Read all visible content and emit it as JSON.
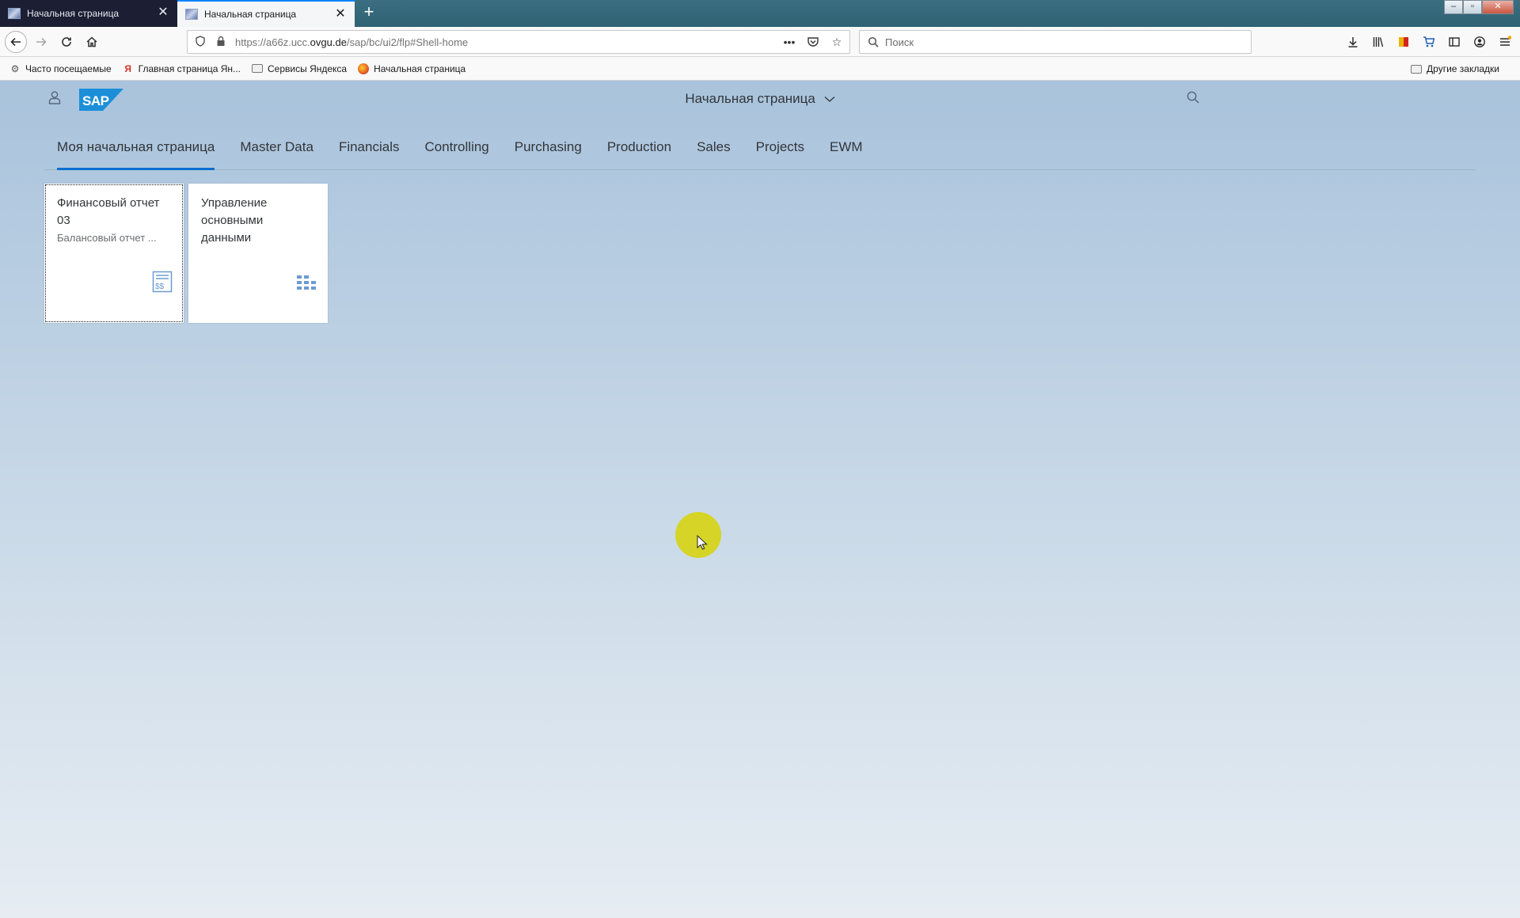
{
  "browser": {
    "tabs": [
      {
        "title": "Начальная страница",
        "active": false
      },
      {
        "title": "Начальная страница",
        "active": true
      }
    ],
    "new_tab_symbol": "+",
    "close_symbol": "✕",
    "window_controls": {
      "minimize": "–",
      "maximize": "▫",
      "close": "✕"
    },
    "url": {
      "prefix": "https://a66z.ucc.",
      "domain": "ovgu.de",
      "path": "/sap/bc/ui2/flp#Shell-home"
    },
    "search_placeholder": "Поиск",
    "bookmarks": [
      {
        "label": "Часто посещаемые",
        "icon": "gear-icon"
      },
      {
        "label": "Главная страница Ян...",
        "icon": "yandex-icon"
      },
      {
        "label": "Сервисы Яндекса",
        "icon": "folder-icon"
      },
      {
        "label": "Начальная страница",
        "icon": "firefox-icon"
      }
    ],
    "other_bookmarks": "Другие закладки"
  },
  "launchpad": {
    "shell_title": "Начальная страница",
    "groups": [
      {
        "label": "Моя начальная страница",
        "active": true
      },
      {
        "label": "Master Data",
        "active": false
      },
      {
        "label": "Financials",
        "active": false
      },
      {
        "label": "Controlling",
        "active": false
      },
      {
        "label": "Purchasing",
        "active": false
      },
      {
        "label": "Production",
        "active": false
      },
      {
        "label": "Sales",
        "active": false
      },
      {
        "label": "Projects",
        "active": false
      },
      {
        "label": "EWM",
        "active": false
      }
    ],
    "tiles": [
      {
        "title": "Финансовый отчет 03",
        "subtitle": "Балансовый отчет ...",
        "icon": "balance-sheet-icon"
      },
      {
        "title": "Управление основными данными",
        "subtitle": "",
        "icon": "grid-icon"
      }
    ]
  },
  "colors": {
    "accent": "#0a6ed1",
    "sap_logo": "#1c8fd8",
    "cursor_highlight": "#d6d41c"
  }
}
